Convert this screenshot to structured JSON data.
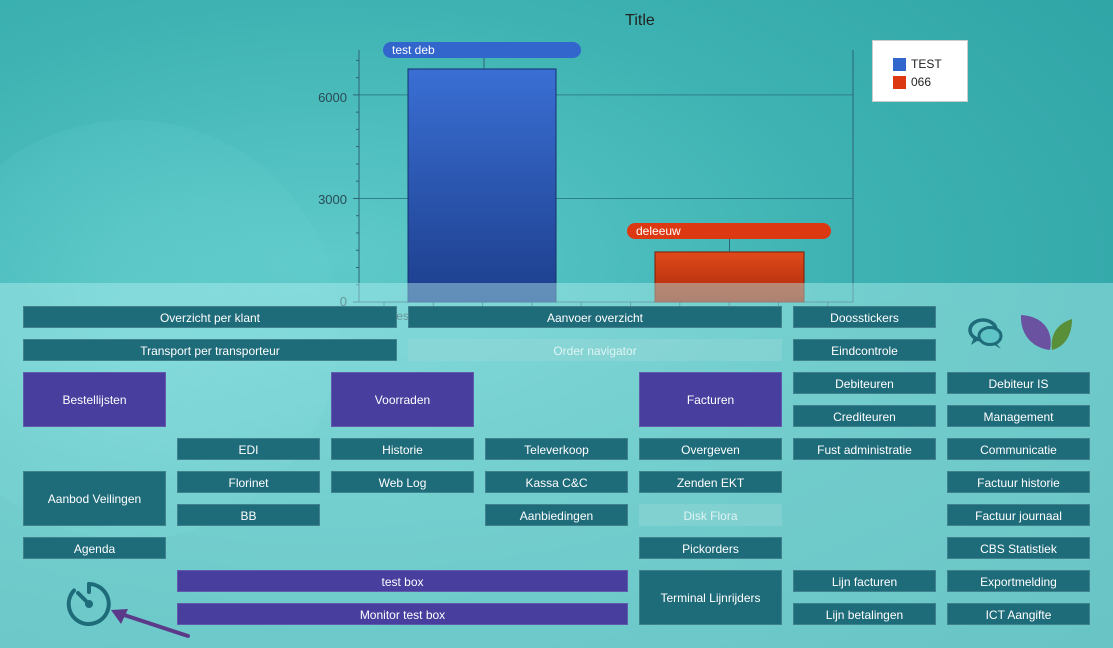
{
  "chart_data": {
    "type": "bar",
    "title": "Title",
    "categories": [
      "test",
      ""
    ],
    "series": [
      {
        "name": "TEST",
        "color": "#3366cc",
        "values": [
          6750,
          null
        ],
        "label": "test deb"
      },
      {
        "name": "066",
        "color": "#dc3912",
        "values": [
          null,
          1450
        ],
        "label": "deleeuw"
      }
    ],
    "ylim": [
      0,
      7300
    ],
    "yticks": [
      0,
      3000,
      6000
    ],
    "legend_position": "top-right",
    "grid": true
  },
  "chart_text": {
    "title": "Title",
    "pill_series1": "test deb",
    "pill_series2": "deleeuw",
    "legend1": "TEST",
    "legend2": "066",
    "tick0": "0",
    "tick1": "3000",
    "tick2": "6000",
    "xtick0": "test"
  },
  "menu": {
    "overzicht_per_klant": "Overzicht per klant",
    "transport_per_transporteur": "Transport per transporteur",
    "aanvoer_overzicht": "Aanvoer overzicht",
    "order_navigator": "Order navigator",
    "doosstickers": "Doosstickers",
    "eindcontrole": "Eindcontrole",
    "bestellijsten": "Bestellijsten",
    "voorraden": "Voorraden",
    "facturen": "Facturen",
    "debiteuren": "Debiteuren",
    "debiteur_is": "Debiteur IS",
    "crediteuren": "Crediteuren",
    "management": "Management",
    "edi": "EDI",
    "historie": "Historie",
    "televerkoop": "Televerkoop",
    "overgeven": "Overgeven",
    "fust_administratie": "Fust administratie",
    "communicatie": "Communicatie",
    "aanbod_veilingen": "Aanbod Veilingen",
    "florinet": "Florinet",
    "web_log": "Web Log",
    "kassa_cc": "Kassa C&C",
    "zenden_ekt": "Zenden EKT",
    "factuur_historie": "Factuur historie",
    "bb": "BB",
    "aanbiedingen": "Aanbiedingen",
    "disk_flora": "Disk Flora",
    "factuur_journaal": "Factuur journaal",
    "agenda": "Agenda",
    "pickorders": "Pickorders",
    "cbs_statistiek": "CBS Statistiek",
    "test_box": "test box",
    "terminal_lijnrijders": "Terminal Lijnrijders",
    "lijn_facturen": "Lijn facturen",
    "exportmelding": "Exportmelding",
    "monitor_test_box": "Monitor test box",
    "lijn_betalingen": "Lijn betalingen",
    "ict_aangifte": "ICT Aangifte"
  },
  "icons": {
    "chat": "chat-bubbles-icon",
    "logo": "leaves-logo",
    "timer": "timer-icon",
    "arrow": "arrow-icon"
  }
}
